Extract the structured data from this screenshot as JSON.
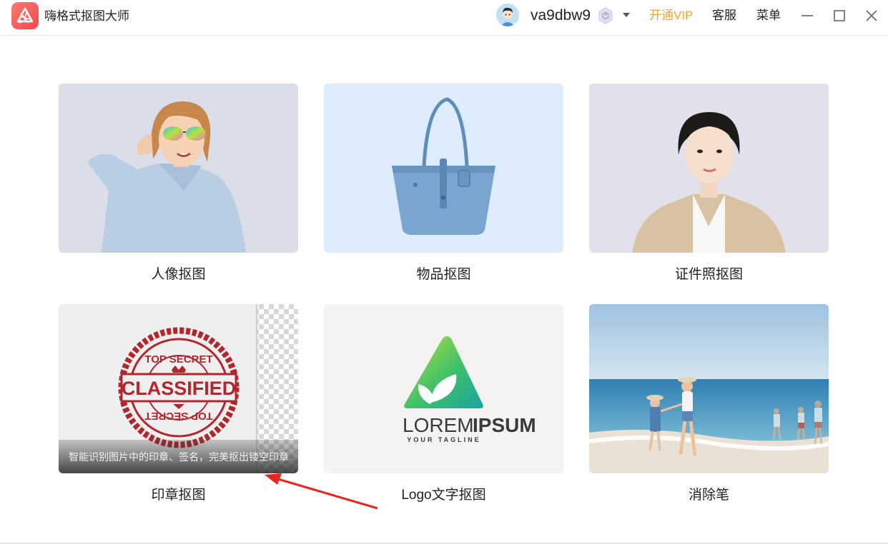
{
  "app": {
    "title": "嗨格式抠图大师",
    "logo_icon": "app-logo-icon"
  },
  "header": {
    "username": "va9dbw9",
    "vip_link": "开通VIP",
    "service_link": "客服",
    "menu_link": "菜单",
    "accent_color": "#f5a623"
  },
  "cards": [
    {
      "label": "人像抠图",
      "image": "child-with-sunglasses-photo",
      "bg": "#d9dee8"
    },
    {
      "label": "物品抠图",
      "image": "blue-handbag-photo",
      "bg": "#ddedfb"
    },
    {
      "label": "证件照抠图",
      "image": "id-photo-woman",
      "bg": "#e2e1ea"
    },
    {
      "label": "印章抠图",
      "image": "classified-stamp-image",
      "bg": "#eeeeee",
      "tooltip": "智能识别图片中的印章、签名，完美抠出镂空印章",
      "stamp_top": "TOP SECRET",
      "stamp_center": "CLASSIFIED",
      "stamp_bottom": "TOP SECRET"
    },
    {
      "label": "Logo文字抠图",
      "image": "lorem-ipsum-logo",
      "bg": "#f4f3f1",
      "logo_text_a": "LOREM",
      "logo_text_b": "IPSUM",
      "logo_tagline": "YOUR TAGLINE"
    },
    {
      "label": "消除笔",
      "image": "beach-family-photo",
      "bg": "#a8c8e0"
    }
  ]
}
